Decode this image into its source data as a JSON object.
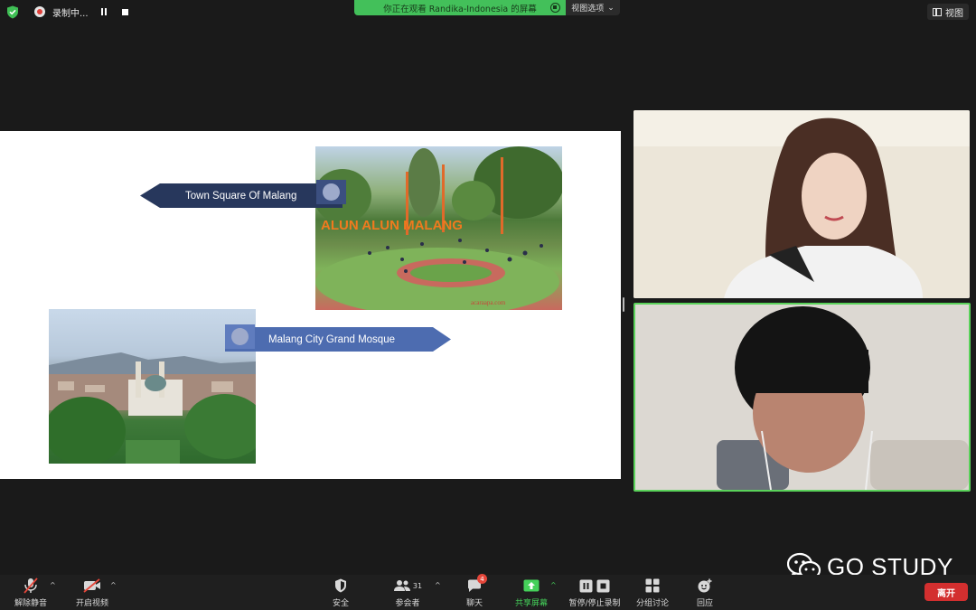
{
  "top": {
    "rec_label": "录制中...",
    "share_banner": "你正在观看 Randika-Indonesia 的屏幕",
    "view_options": "视图选项",
    "view_button": "视图"
  },
  "slide": {
    "label_square": "Town Square Of Malang",
    "label_mosque": "Malang City Grand Mosque",
    "photo_square_sign": "ALUN ALUN MALANG",
    "photo_square_credit": "acaraapa.com"
  },
  "watermark": {
    "text": "GO STUDY"
  },
  "toolbar": {
    "mute": "解除静音",
    "video": "开启视频",
    "security": "安全",
    "participants": "参会者",
    "participants_count": "31",
    "chat": "聊天",
    "chat_badge": "4",
    "share": "共享屏幕",
    "record": "暂停/停止录制",
    "breakout": "分组讨论",
    "reactions": "回应",
    "leave": "离开"
  },
  "colors": {
    "share_green": "#43c05a",
    "active_speaker_border": "#5ad25a",
    "leave_red": "#d32f2f",
    "arrow_dark": "#27375c",
    "arrow_blue": "#4d6cb0"
  }
}
